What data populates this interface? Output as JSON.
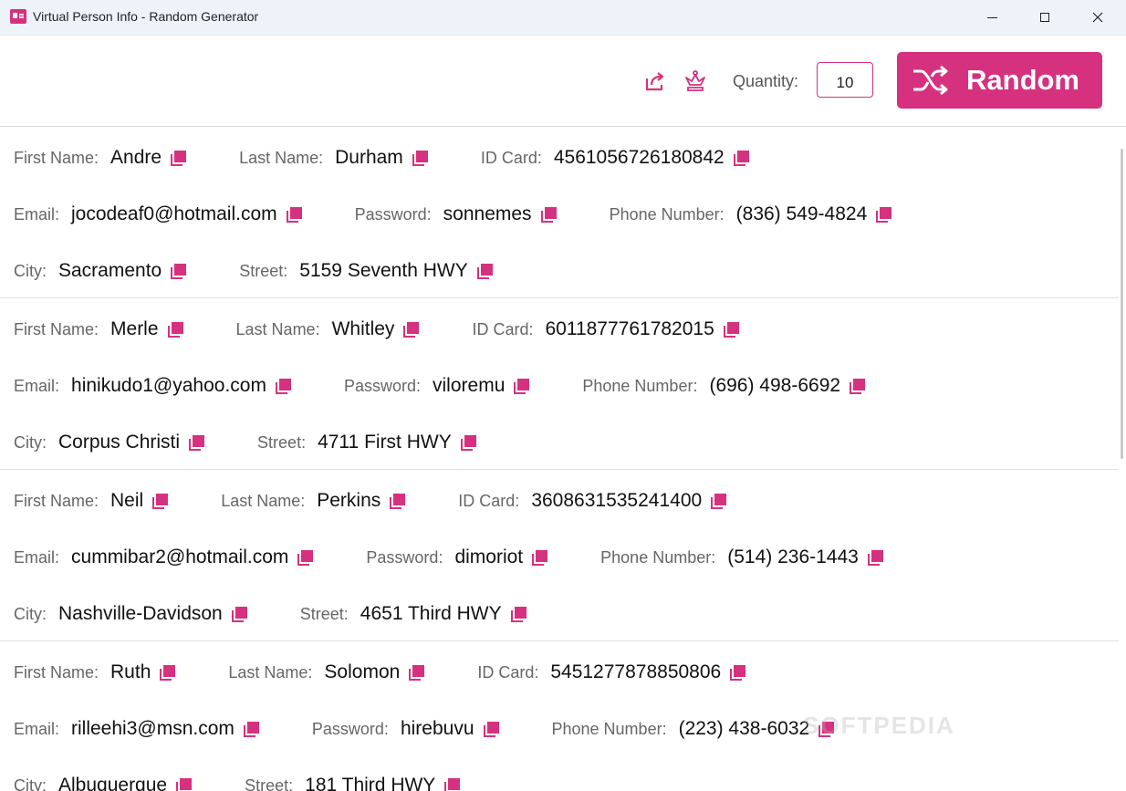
{
  "window": {
    "title": "Virtual Person Info - Random Generator"
  },
  "toolbar": {
    "quantity_label": "Quantity:",
    "quantity_value": "10",
    "random_label": "Random"
  },
  "labels": {
    "first_name": "First Name:",
    "last_name": "Last Name:",
    "id_card": "ID Card:",
    "email": "Email:",
    "password": "Password:",
    "phone": "Phone Number:",
    "city": "City:",
    "street": "Street:"
  },
  "persons": [
    {
      "first_name": "Andre",
      "last_name": "Durham",
      "id_card": "4561056726180842",
      "email": "jocodeaf0@hotmail.com",
      "password": "sonnemes",
      "phone": "(836) 549-4824",
      "city": "Sacramento",
      "street": "5159 Seventh HWY"
    },
    {
      "first_name": "Merle",
      "last_name": "Whitley",
      "id_card": "6011877761782015",
      "email": "hinikudo1@yahoo.com",
      "password": "viloremu",
      "phone": "(696) 498-6692",
      "city": "Corpus Christi",
      "street": "4711 First HWY"
    },
    {
      "first_name": "Neil",
      "last_name": "Perkins",
      "id_card": "3608631535241400",
      "email": "cummibar2@hotmail.com",
      "password": "dimoriot",
      "phone": "(514) 236-1443",
      "city": "Nashville-Davidson",
      "street": "4651 Third HWY"
    },
    {
      "first_name": "Ruth",
      "last_name": "Solomon",
      "id_card": "5451277878850806",
      "email": "rilleehi3@msn.com",
      "password": "hirebuvu",
      "phone": "(223) 438-6032",
      "city": "Albuquerque",
      "street": "181 Third HWY"
    }
  ],
  "watermark": "SOFTPEDIA",
  "colors": {
    "accent": "#d6317e",
    "titlebar": "#eef3fa"
  }
}
